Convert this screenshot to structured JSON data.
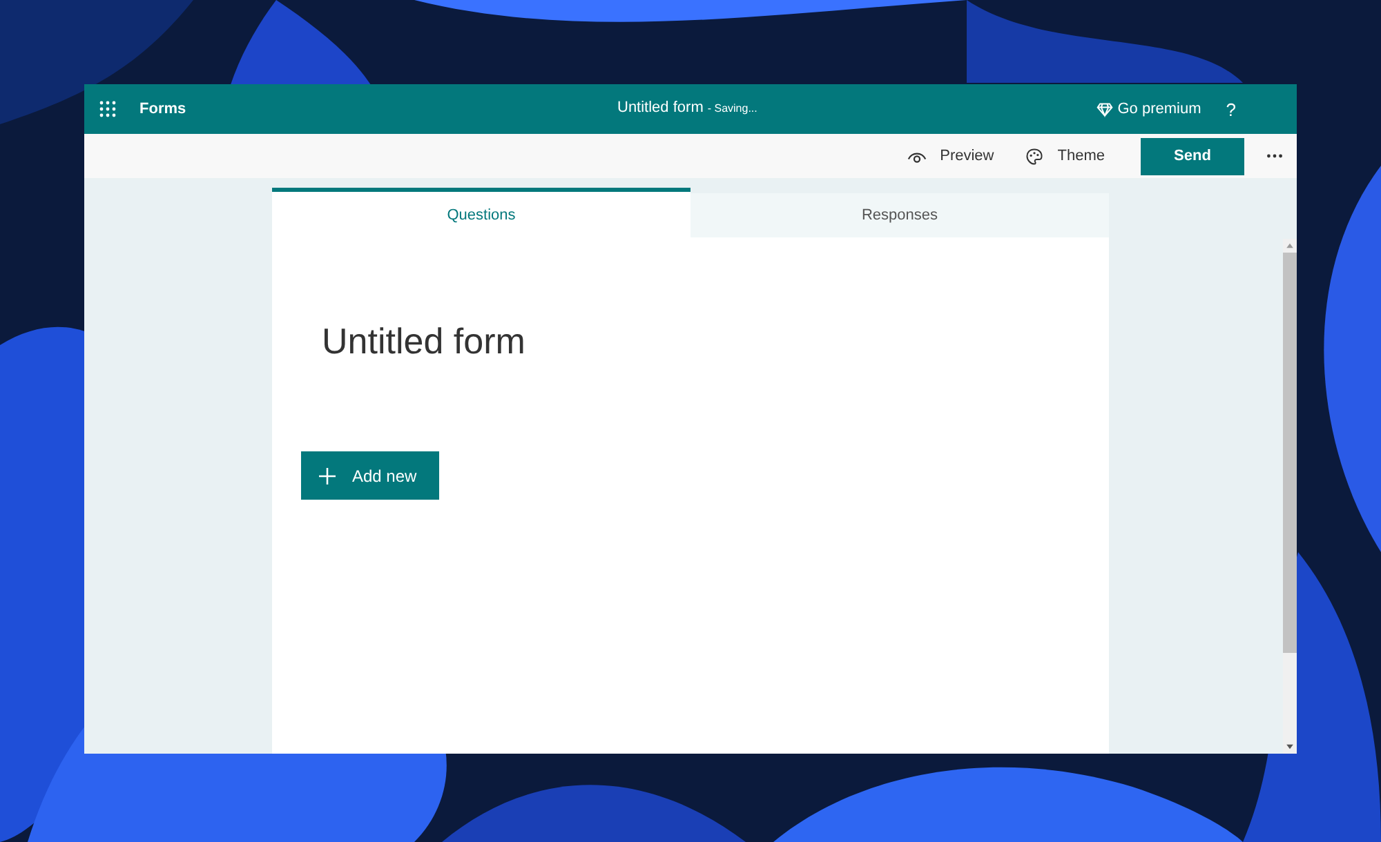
{
  "header": {
    "app_name": "Forms",
    "document_title": "Untitled form",
    "save_status": "- Saving...",
    "premium": "Go premium",
    "help": "?"
  },
  "toolbar": {
    "actions": [
      {
        "kind": "preview",
        "label": "Preview"
      },
      {
        "kind": "theme",
        "label": "Theme"
      }
    ],
    "send": "Send"
  },
  "tabs": [
    {
      "label": "Questions",
      "selected": true
    },
    {
      "label": "Responses",
      "selected": false
    }
  ],
  "form": {
    "title": "Untitled form",
    "add_button": "Add new"
  }
}
